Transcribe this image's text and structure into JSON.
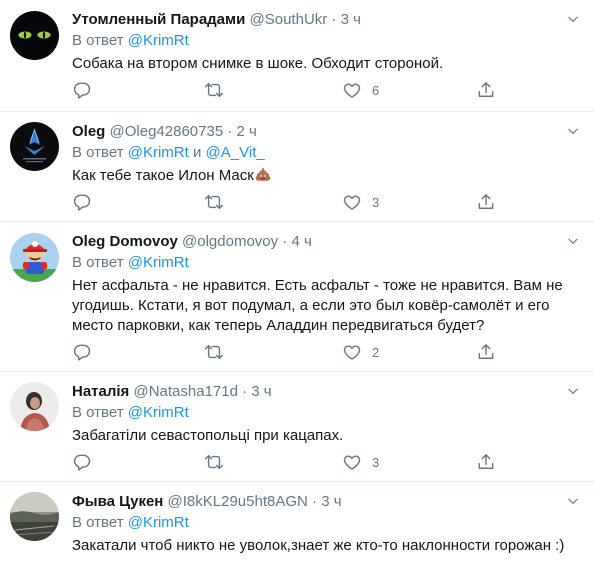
{
  "tweets": [
    {
      "name": "Утомленный Парадами",
      "handle": "@SouthUkr",
      "dot": "·",
      "time": "3 ч",
      "reply_label": "В ответ",
      "reply_mentions": [
        "@KrimRt"
      ],
      "text_lines": [
        "Собака на втором снимке в шоке. Обходит стороной."
      ],
      "likes": "6"
    },
    {
      "name": "Oleg",
      "handle": "@Oleg42860735",
      "dot": "·",
      "time": "2 ч",
      "reply_label": "В ответ",
      "reply_mentions": [
        "@KrimRt",
        "@A_Vit_"
      ],
      "reply_conj": "и",
      "text_lines": [
        "Как тебе такое Илон Маск"
      ],
      "likes": "3",
      "emoji": "poo-emoji"
    },
    {
      "name": "Oleg Domovoy",
      "handle": "@olgdomovoy",
      "dot": "·",
      "time": "4 ч",
      "reply_label": "В ответ",
      "reply_mentions": [
        "@KrimRt"
      ],
      "text_lines": [
        "Нет асфальта - не нравится. Есть асфальт - тоже не нравится. Вам не",
        "угодишь. Кстати, я вот подумал, а если это был ковёр-самолёт и его",
        "место парковки, как теперь Аладдин передвигаться будет?"
      ],
      "likes": "2"
    },
    {
      "name": "Наталія",
      "handle": "@Natasha171d",
      "dot": "·",
      "time": "3 ч",
      "reply_label": "В ответ",
      "reply_mentions": [
        "@KrimRt"
      ],
      "text_lines": [
        "Забагатіли севастопольці при кацапах."
      ],
      "likes": "3"
    },
    {
      "name": "Фыва Цукен",
      "handle": "@I8kKL29u5ht8AGN",
      "dot": "·",
      "time": "3 ч",
      "reply_label": "В ответ",
      "reply_mentions": [
        "@KrimRt"
      ],
      "text_lines": [
        "Закатали чтоб никто не уволок,знает же кто-то наклонности горожан :)"
      ]
    }
  ],
  "colors": {
    "link": "#1b95e0",
    "muted": "#657786",
    "text": "#14171a",
    "divider": "#e6ecf0"
  },
  "icons": [
    "reply-icon",
    "retweet-icon",
    "like-icon",
    "share-icon",
    "caret-down-icon"
  ]
}
